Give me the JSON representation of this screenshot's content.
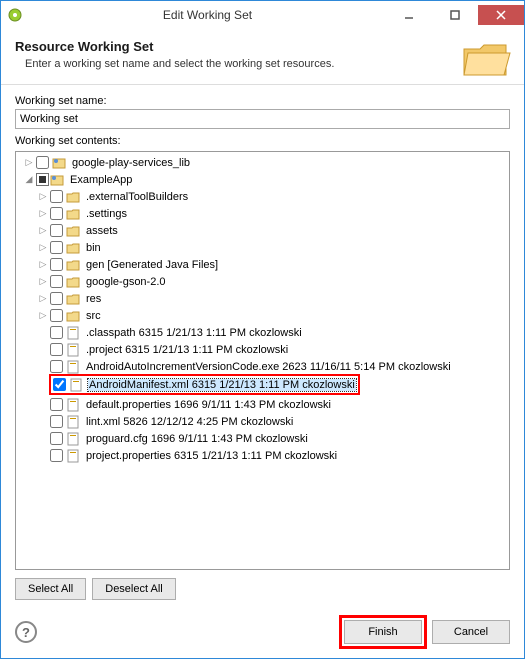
{
  "titlebar": {
    "title": "Edit Working Set"
  },
  "header": {
    "title": "Resource Working Set",
    "subtitle": "Enter a working set name and select the working set resources."
  },
  "form": {
    "name_label": "Working set name:",
    "name_value": "Working set",
    "contents_label": "Working set contents:"
  },
  "tree": {
    "root1": "google-play-services_lib",
    "root2": "ExampleApp",
    "children": [
      ".externalToolBuilders",
      ".settings",
      "assets",
      "bin",
      "gen [Generated Java Files]",
      "google-gson-2.0",
      "res",
      "src"
    ],
    "files": [
      ".classpath 6315  1/21/13 1:11 PM  ckozlowski",
      ".project 6315  1/21/13 1:11 PM  ckozlowski",
      "AndroidAutoIncrementVersionCode.exe 2623  11/16/11 5:14 PM  ckozlowski",
      "AndroidManifest.xml 6315  1/21/13 1:11 PM  ckozlowski",
      "default.properties 1696  9/1/11 1:43 PM  ckozlowski",
      "lint.xml 5826  12/12/12 4:25 PM  ckozlowski",
      "proguard.cfg 1696  9/1/11 1:43 PM  ckozlowski",
      "project.properties 6315  1/21/13 1:11 PM  ckozlowski"
    ]
  },
  "buttons": {
    "select_all": "Select All",
    "deselect_all": "Deselect All",
    "finish": "Finish",
    "cancel": "Cancel"
  }
}
